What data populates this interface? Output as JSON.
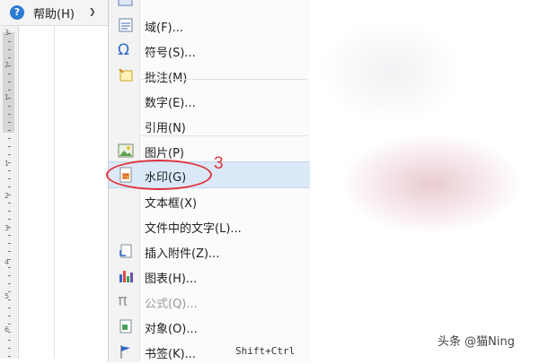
{
  "topmenu": {
    "help_label": "帮助",
    "help_shortcut": "(H)",
    "help_icon": "help-circle-icon"
  },
  "ruler": {
    "labels": [
      "3",
      "2",
      "1",
      "1",
      "2",
      "3",
      "4",
      "5",
      "6"
    ]
  },
  "menu": {
    "items": [
      {
        "name": "menu-item-field",
        "label": "域(F)...",
        "icon": "field-icon",
        "disabled": false,
        "selected": false
      },
      {
        "name": "menu-item-symbol",
        "label": "符号(S)...",
        "icon": "omega-icon",
        "disabled": false,
        "selected": false
      },
      {
        "name": "menu-item-comment",
        "label": "批注(M)",
        "icon": "comment-icon",
        "disabled": false,
        "selected": false
      },
      {
        "name": "menu-item-number",
        "label": "数字(E)...",
        "icon": "",
        "disabled": false,
        "selected": false
      },
      {
        "name": "menu-item-reference",
        "label": "引用(N)",
        "icon": "",
        "disabled": false,
        "selected": false
      },
      {
        "name": "menu-item-picture",
        "label": "图片(P)",
        "icon": "picture-icon",
        "disabled": false,
        "selected": false
      },
      {
        "name": "menu-item-watermark",
        "label": "水印(G)",
        "icon": "watermark-icon",
        "disabled": false,
        "selected": true
      },
      {
        "name": "menu-item-textbox",
        "label": "文本框(X)",
        "icon": "",
        "disabled": false,
        "selected": false
      },
      {
        "name": "menu-item-text-from-file",
        "label": "文件中的文字(L)...",
        "icon": "",
        "disabled": false,
        "selected": false
      },
      {
        "name": "menu-item-attachment",
        "label": "插入附件(Z)...",
        "icon": "attachment-icon",
        "disabled": false,
        "selected": false
      },
      {
        "name": "menu-item-chart",
        "label": "图表(H)...",
        "icon": "chart-icon",
        "disabled": false,
        "selected": false
      },
      {
        "name": "menu-item-formula",
        "label": "公式(Q)...",
        "icon": "pi-icon",
        "disabled": true,
        "selected": false
      },
      {
        "name": "menu-item-object",
        "label": "对象(O)...",
        "icon": "object-icon",
        "disabled": false,
        "selected": false
      },
      {
        "name": "menu-item-bookmark",
        "label": "书签(K)...",
        "icon": "flag-icon",
        "disabled": false,
        "selected": false,
        "shortcut": "Shift+Ctrl"
      }
    ]
  },
  "annotation": {
    "step": "3",
    "color": "#e0343b"
  },
  "watermark_text": "头条 @猫Ning",
  "colors": {
    "selected_bg": "#dbe8f8",
    "help_icon_bg": "#2b7bd3"
  }
}
